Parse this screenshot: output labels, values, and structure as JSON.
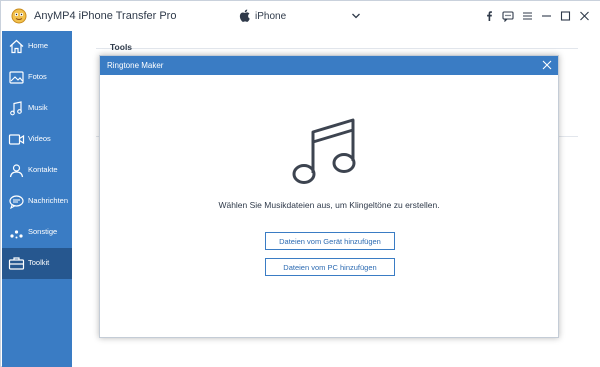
{
  "app": {
    "title": "AnyMP4 iPhone Transfer Pro",
    "device": "iPhone"
  },
  "window_controls": [
    "facebook-icon",
    "feedback-icon",
    "menu-icon",
    "minimize-icon",
    "maximize-icon",
    "close-icon"
  ],
  "sidebar": {
    "items": [
      {
        "label": "Home",
        "icon": "home-icon"
      },
      {
        "label": "Fotos",
        "icon": "photos-icon"
      },
      {
        "label": "Musik",
        "icon": "music-icon"
      },
      {
        "label": "Videos",
        "icon": "video-icon"
      },
      {
        "label": "Kontakte",
        "icon": "contacts-icon"
      },
      {
        "label": "Nachrichten",
        "icon": "messages-icon"
      },
      {
        "label": "Sonstige",
        "icon": "other-icon"
      },
      {
        "label": "Toolkit",
        "icon": "toolkit-icon",
        "active": true
      }
    ]
  },
  "main": {
    "section_title": "Tools"
  },
  "modal": {
    "title": "Ringtone Maker",
    "instruction": "Wählen Sie Musikdateien aus, um Klingeltöne zu erstellen.",
    "add_from_device": "Dateien vom Gerät hinzufügen",
    "add_from_pc": "Dateien vom PC hinzufügen"
  },
  "colors": {
    "accent": "#3a7cc4",
    "sidebar_active": "#26578f"
  }
}
